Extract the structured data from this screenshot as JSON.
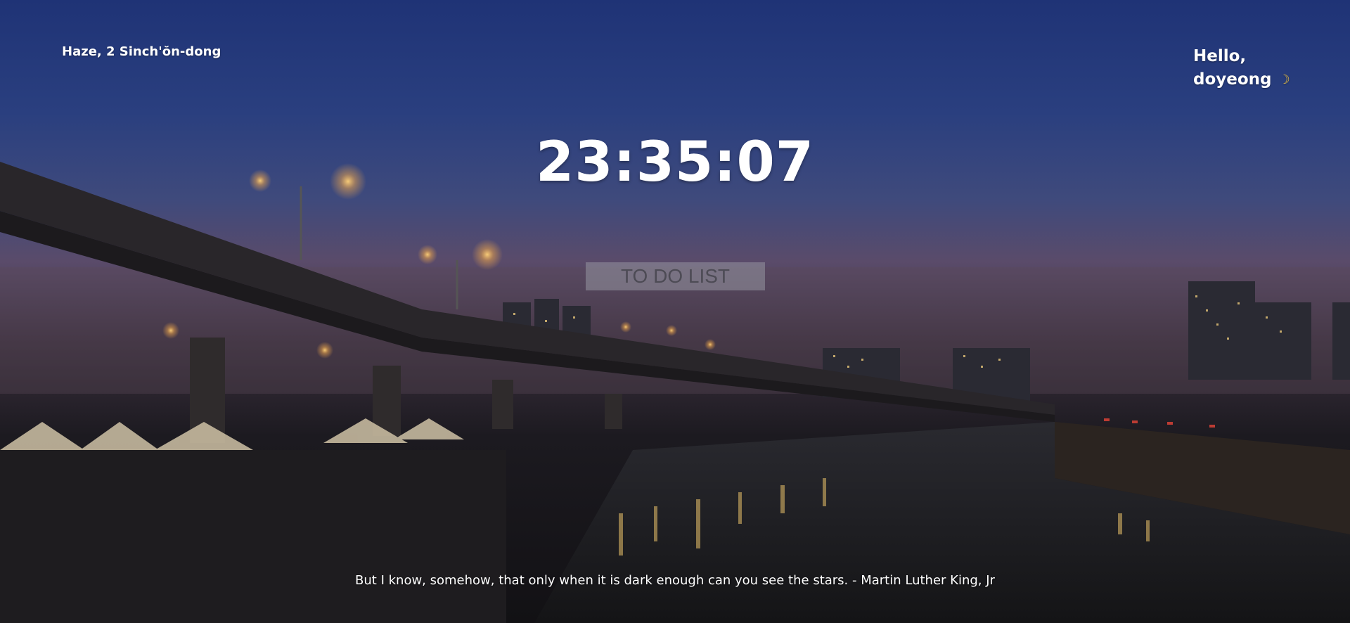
{
  "weather": {
    "text": "Haze, 2 Sinch'ŏn-dong"
  },
  "greeting": {
    "line1": "Hello,",
    "line2": "doyeong",
    "icon": "crescent-moon-icon"
  },
  "clock": {
    "time": "23:35:07"
  },
  "todo": {
    "label": "TO DO LIST"
  },
  "quote": {
    "text": "But I know, somehow, that only when it is dark enough can you see the stars. - Martin Luther King, Jr"
  },
  "colors": {
    "sky_top": "#1f3376",
    "text": "#ffffff",
    "todo_bg": "#96969f",
    "todo_text": "#4d4b55",
    "moon": "#e8c24a"
  }
}
